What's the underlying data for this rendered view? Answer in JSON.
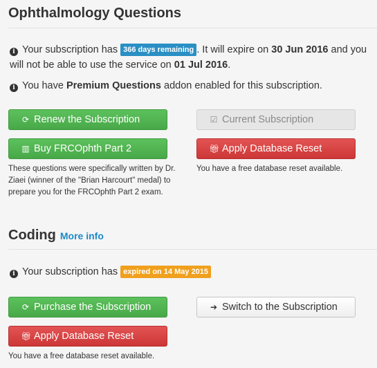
{
  "ophthalmology": {
    "title": "Ophthalmology Questions",
    "info1_prefix": "Your subscription has",
    "info1_badge": "366 days remaining",
    "info1_mid": ". It will expire on",
    "info1_expire": "30 Jun 2016",
    "info1_mid2": "and you will not be able to use the service on",
    "info1_date": "01 Jul 2016",
    "info1_end": ".",
    "info2_prefix": "You have",
    "info2_bold": "Premium Questions",
    "info2_end": "addon enabled for this subscription.",
    "renew_label": "Renew the Subscription",
    "current_label": "Current Subscription",
    "buy_label": "Buy FRCOphth Part 2",
    "reset_label": "Apply Database Reset",
    "buy_note": "These questions were specifically written by Dr. Ziaei (winner of the \"Brian Harcourt\" medal) to prepare you for the FRCOphth Part 2 exam.",
    "reset_note": "You have a free database reset available."
  },
  "coding": {
    "title": "Coding",
    "more_info": "More info",
    "info_prefix": "Your subscription has",
    "info_badge": "expired on 14 May 2015",
    "purchase_label": "Purchase the Subscription",
    "switch_label": "Switch to the Subscription",
    "reset_label": "Apply Database Reset",
    "reset_note": "You have a free database reset available."
  },
  "colors": {
    "green": "#4cae4c",
    "red": "#d9534f",
    "badge_blue": "#2a8fc4",
    "badge_orange": "#f0a01d",
    "link": "#1a8ac9"
  }
}
